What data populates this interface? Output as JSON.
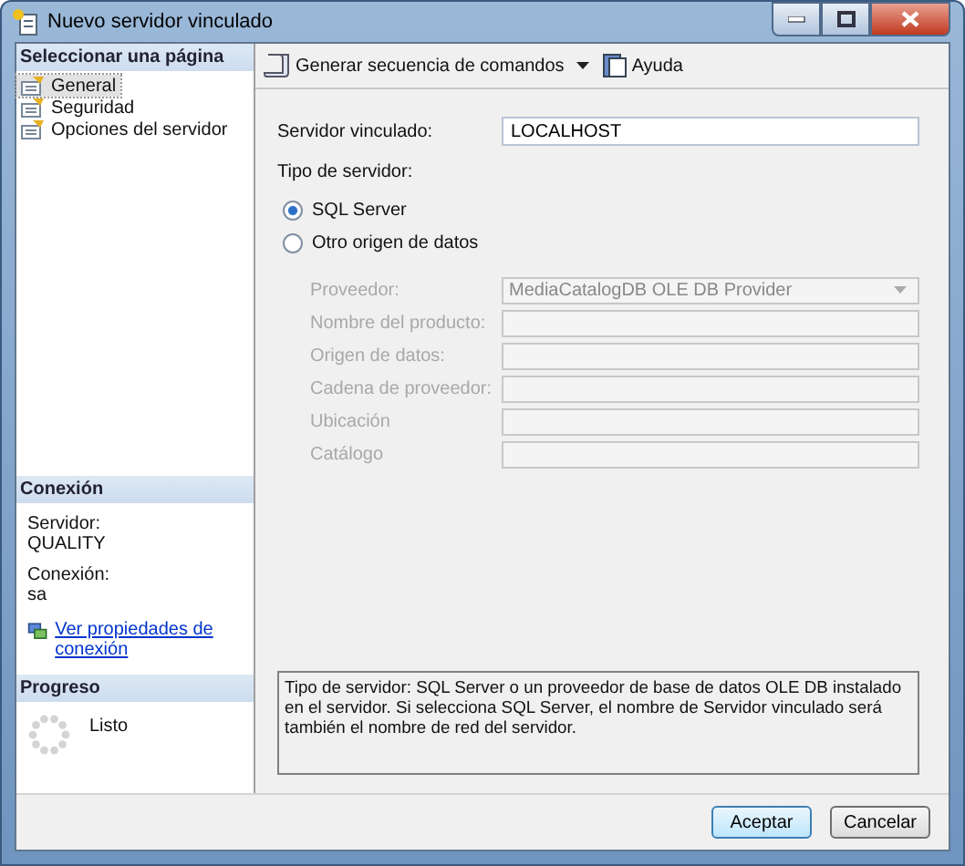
{
  "window": {
    "title": "Nuevo servidor vinculado"
  },
  "sidebar": {
    "header": "Seleccionar una página",
    "pages": [
      {
        "label": "General",
        "selected": true
      },
      {
        "label": "Seguridad",
        "selected": false
      },
      {
        "label": "Opciones del servidor",
        "selected": false
      }
    ]
  },
  "connection": {
    "header": "Conexión",
    "server_label": "Servidor:",
    "server": "QUALITY",
    "connection_label": "Conexión:",
    "connection": "sa",
    "link": "Ver propiedades de conexión"
  },
  "progress": {
    "header": "Progreso",
    "status": "Listo"
  },
  "toolbar": {
    "script_button": "Generar secuencia de comandos",
    "help_button": "Ayuda"
  },
  "form": {
    "linked_server": {
      "label": "Servidor vinculado:",
      "value": "LOCALHOST"
    },
    "server_type": {
      "label": "Tipo de servidor:",
      "options": [
        {
          "label": "SQL Server",
          "selected": true
        },
        {
          "label": "Otro origen de datos",
          "selected": false
        }
      ]
    },
    "provider": {
      "label": "Proveedor:",
      "value": "MediaCatalogDB OLE DB Provider",
      "disabled": true
    },
    "fields": [
      {
        "label": "Nombre del producto:",
        "disabled": true
      },
      {
        "label": "Origen de datos:",
        "disabled": true
      },
      {
        "label": "Cadena de proveedor:",
        "disabled": true
      },
      {
        "label": "Ubicación",
        "disabled": true
      },
      {
        "label": "Catálogo",
        "disabled": true
      }
    ]
  },
  "description": "Tipo de servidor: SQL Server o un proveedor de base de datos OLE DB instalado en el servidor. Si selecciona SQL Server, el nombre de Servidor vinculado será también el nombre de red del servidor.",
  "buttons": [
    {
      "label": "Aceptar",
      "default": true
    },
    {
      "label": "Cancelar",
      "default": false
    }
  ]
}
